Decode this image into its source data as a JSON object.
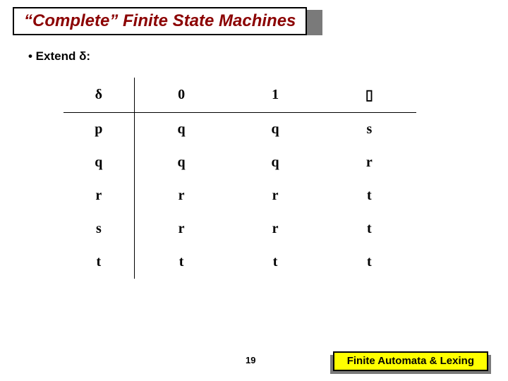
{
  "title": "“Complete” Finite State Machines",
  "bullet": "•  Extend δ:",
  "table": {
    "head_symbol": "δ",
    "columns": [
      "0",
      "1",
      "▯"
    ],
    "rows": [
      {
        "state": "p",
        "cells": [
          "q",
          "q",
          "s"
        ]
      },
      {
        "state": "q",
        "cells": [
          "q",
          "q",
          "r"
        ]
      },
      {
        "state": "r",
        "cells": [
          "r",
          "r",
          "t"
        ]
      },
      {
        "state": "s",
        "cells": [
          "r",
          "r",
          "t"
        ]
      },
      {
        "state": "t",
        "cells": [
          "t",
          "t",
          "t"
        ]
      }
    ]
  },
  "page_number": "19",
  "footer": "Finite Automata & Lexing"
}
